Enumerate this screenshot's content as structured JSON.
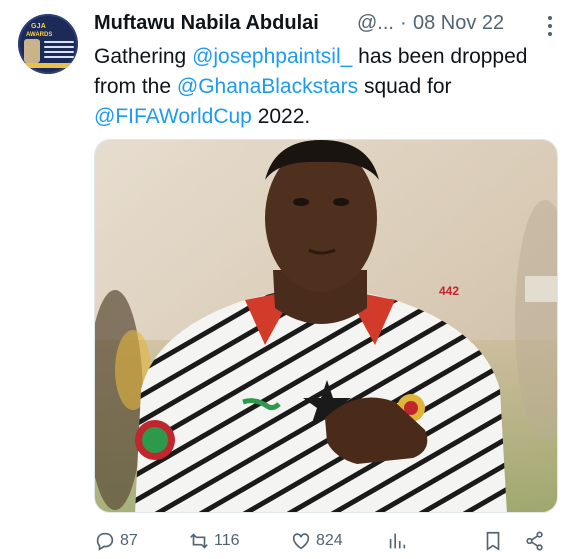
{
  "tweet": {
    "author": "Muftawu Nabila Abdulai",
    "handle": "@...",
    "separator": "·",
    "date": "08 Nov 22",
    "text": {
      "p1": "Gathering ",
      "m1": "@josephpaintsil_",
      "p2": " has been dropped from the ",
      "m2": "@GhanaBlackstars",
      "p3": " squad for ",
      "m3": "@FIFAWorldCup",
      "p4": " 2022."
    }
  },
  "avatar": {
    "line1": "GJA",
    "line2": "AWARDS"
  },
  "media": {
    "watermark": "442"
  },
  "actions": {
    "replies": "87",
    "retweets": "116",
    "likes": "824"
  },
  "colors": {
    "link": "#1d9bf0",
    "muted": "#536471",
    "text": "#0f1419"
  },
  "icons": [
    "more-icon",
    "reply-icon",
    "retweet-icon",
    "like-icon",
    "views-icon",
    "bookmark-icon",
    "share-icon"
  ]
}
